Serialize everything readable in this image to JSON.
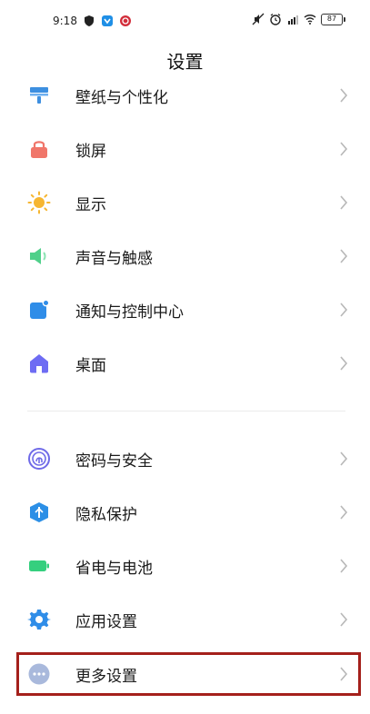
{
  "status_bar": {
    "time": "9:18",
    "battery": "87",
    "left_icons": [
      "shield-icon",
      "download-icon",
      "app-badge-icon"
    ],
    "right_icons": [
      "mute-icon",
      "alarm-icon",
      "signal-icon",
      "wifi-icon",
      "battery-icon"
    ]
  },
  "header": {
    "title": "设置"
  },
  "groups": [
    {
      "items": [
        {
          "label": "壁纸与个性化",
          "icon": "wallpaper-icon",
          "color": "#3d8fe0"
        },
        {
          "label": "锁屏",
          "icon": "lock-icon",
          "color": "#f0766a"
        },
        {
          "label": "显示",
          "icon": "sun-icon",
          "color": "#f6b631"
        },
        {
          "label": "声音与触感",
          "icon": "speaker-icon",
          "color": "#4fd08a"
        },
        {
          "label": "通知与控制中心",
          "icon": "notification-icon",
          "color": "#2f8de8"
        },
        {
          "label": "桌面",
          "icon": "home-icon",
          "color": "#6e6cf3"
        }
      ]
    },
    {
      "items": [
        {
          "label": "密码与安全",
          "icon": "fingerprint-icon",
          "color": "#6f6ae8"
        },
        {
          "label": "隐私保护",
          "icon": "privacy-icon",
          "color": "#2c8fe6"
        },
        {
          "label": "省电与电池",
          "icon": "battery-saver-icon",
          "color": "#35cf7e"
        },
        {
          "label": "应用设置",
          "icon": "gear-icon",
          "color": "#2f8de8"
        },
        {
          "label": "更多设置",
          "icon": "more-icon",
          "color": "#a9b9dc"
        }
      ]
    }
  ],
  "accent": {
    "highlight": "#a4201b"
  }
}
